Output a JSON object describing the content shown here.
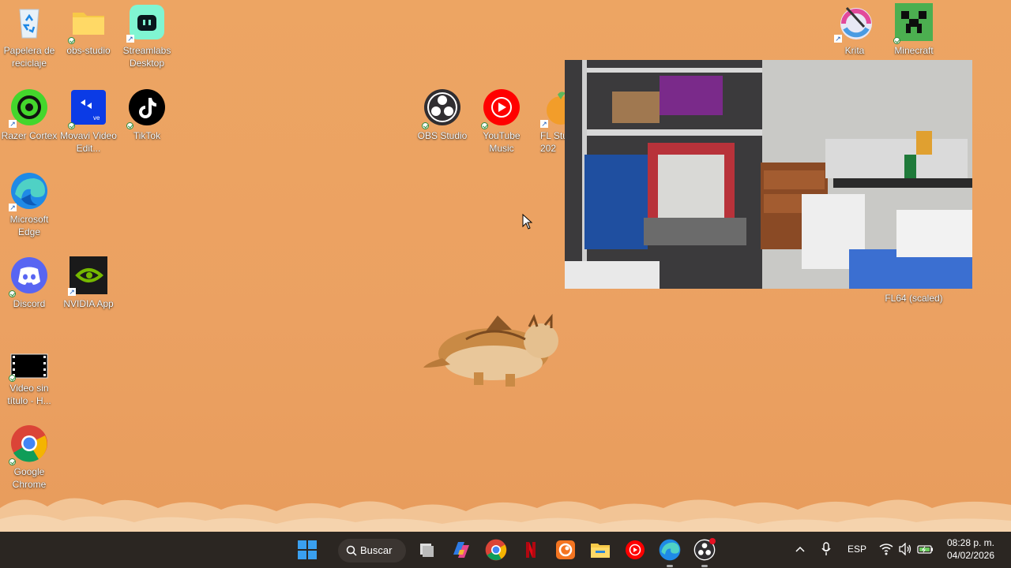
{
  "desktop": {
    "icons": {
      "recycle_bin": "Papelera de reciclaje",
      "obs_studio_folder": "obs-studio",
      "streamlabs": "Streamlabs Desktop",
      "razer_cortex": "Razer Cortex",
      "movavi": "Movavi Video Edit...",
      "tiktok": "TikTok",
      "edge": "Microsoft Edge",
      "discord": "Discord",
      "nvidia": "NVIDIA App",
      "video": "Video sin título - H...",
      "chrome": "Google Chrome",
      "obs_studio_app": "OBS Studio",
      "youtube_music": "YouTube Music",
      "fl_studio": "FL Stu 202",
      "krita": "Krita",
      "minecraft": "Minecraft",
      "fl64": "FL64 (scaled)"
    }
  },
  "taskbar": {
    "search_label": "Buscar",
    "language": "ESP",
    "time": "08:28 p. m.",
    "date": "04/02/2026"
  },
  "colors": {
    "desktop_bg": "#eba161",
    "taskbar_bg": "#2b2622"
  }
}
